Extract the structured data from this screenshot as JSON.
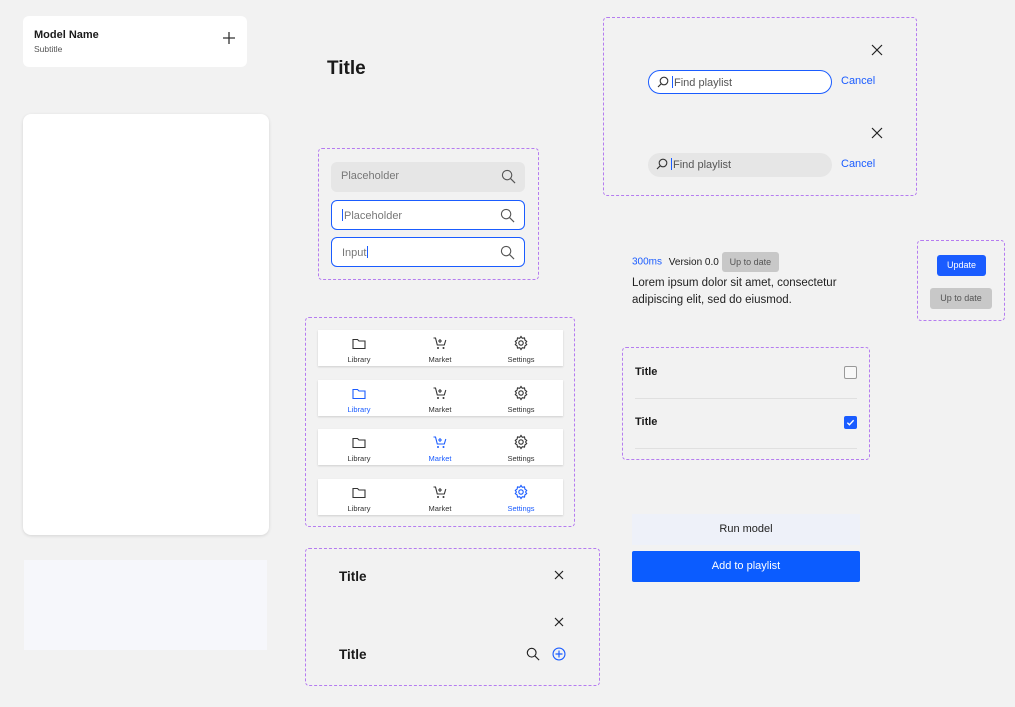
{
  "model_card": {
    "name": "Model Name",
    "subtitle": "Subtitle",
    "add_icon": "plus-icon"
  },
  "page_title": "Title",
  "search_fields": [
    {
      "state": "default",
      "placeholder": "Placeholder",
      "icon": "search-icon"
    },
    {
      "state": "focused",
      "placeholder": "Placeholder",
      "icon": "search-icon"
    },
    {
      "state": "filled",
      "value": "Input",
      "icon": "search-icon"
    }
  ],
  "nav_items": [
    {
      "label": "Library",
      "icon": "folder-icon"
    },
    {
      "label": "Market",
      "icon": "cart-icon"
    },
    {
      "label": "Settings",
      "icon": "gear-icon"
    }
  ],
  "nav_bars_active": [
    null,
    "Library",
    "Market",
    "Settings"
  ],
  "headers": [
    {
      "title": "Title",
      "actions": [
        "close-icon"
      ]
    },
    {
      "title": "Title",
      "actions": [
        "close-icon",
        "search-icon",
        "add-circle-icon"
      ]
    }
  ],
  "find_playlist": [
    {
      "style": "outline",
      "placeholder": "Find playlist",
      "cancel": "Cancel"
    },
    {
      "style": "filled",
      "placeholder": "Find playlist",
      "cancel": "Cancel"
    }
  ],
  "version": {
    "latency": "300ms",
    "version": "Version 0.0",
    "status": "Up to date"
  },
  "description": "Lorem ipsum dolor sit amet, consectetur adipiscing elit, sed do eiusmod.",
  "update_buttons": {
    "update": "Update",
    "up_to_date": "Up to date"
  },
  "checklist": [
    {
      "title": "Title",
      "checked": false
    },
    {
      "title": "Title",
      "checked": true
    }
  ],
  "buttons": {
    "run": "Run model",
    "add": "Add to playlist"
  },
  "colors": {
    "accent": "#1a5cff",
    "dashed_border": "#b57cf0",
    "background": "#f2f2f2"
  }
}
